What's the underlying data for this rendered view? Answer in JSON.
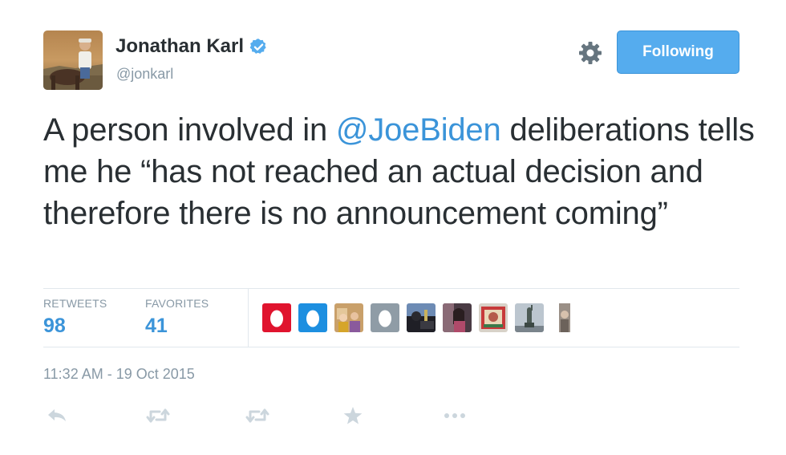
{
  "author": {
    "name": "Jonathan Karl",
    "handle": "@jonkarl",
    "avatar_icon": "avatar-photo-horse-rider",
    "verified_icon": "verified-badge-icon"
  },
  "follow_button": {
    "label": "Following"
  },
  "settings_icon": "gear-icon",
  "tweet": {
    "text_before": "A person involved in ",
    "mention": "@JoeBiden",
    "text_after": " deliberations tells me he “has not reached an actual decision and therefore there is no announcement coming”"
  },
  "stats": {
    "retweets_label": "RETWEETS",
    "retweets_value": "98",
    "favorites_label": "FAVORITES",
    "favorites_value": "41"
  },
  "favoriter_avatars": [
    "egg-avatar-red",
    "egg-avatar-blue",
    "photo-avatar",
    "egg-avatar-gray",
    "photo-avatar",
    "photo-avatar",
    "photo-avatar",
    "photo-avatar",
    "photo-avatar"
  ],
  "timestamp": "11:32 AM - 19 Oct 2015",
  "actions": [
    "reply-icon",
    "retweet-icon",
    "retweet-icon",
    "favorite-star-icon",
    "more-icon"
  ],
  "colors": {
    "accent": "#55acee",
    "link": "#3b94d9",
    "text": "#292f33",
    "muted": "#8899a6",
    "border": "#e1e8ed"
  }
}
